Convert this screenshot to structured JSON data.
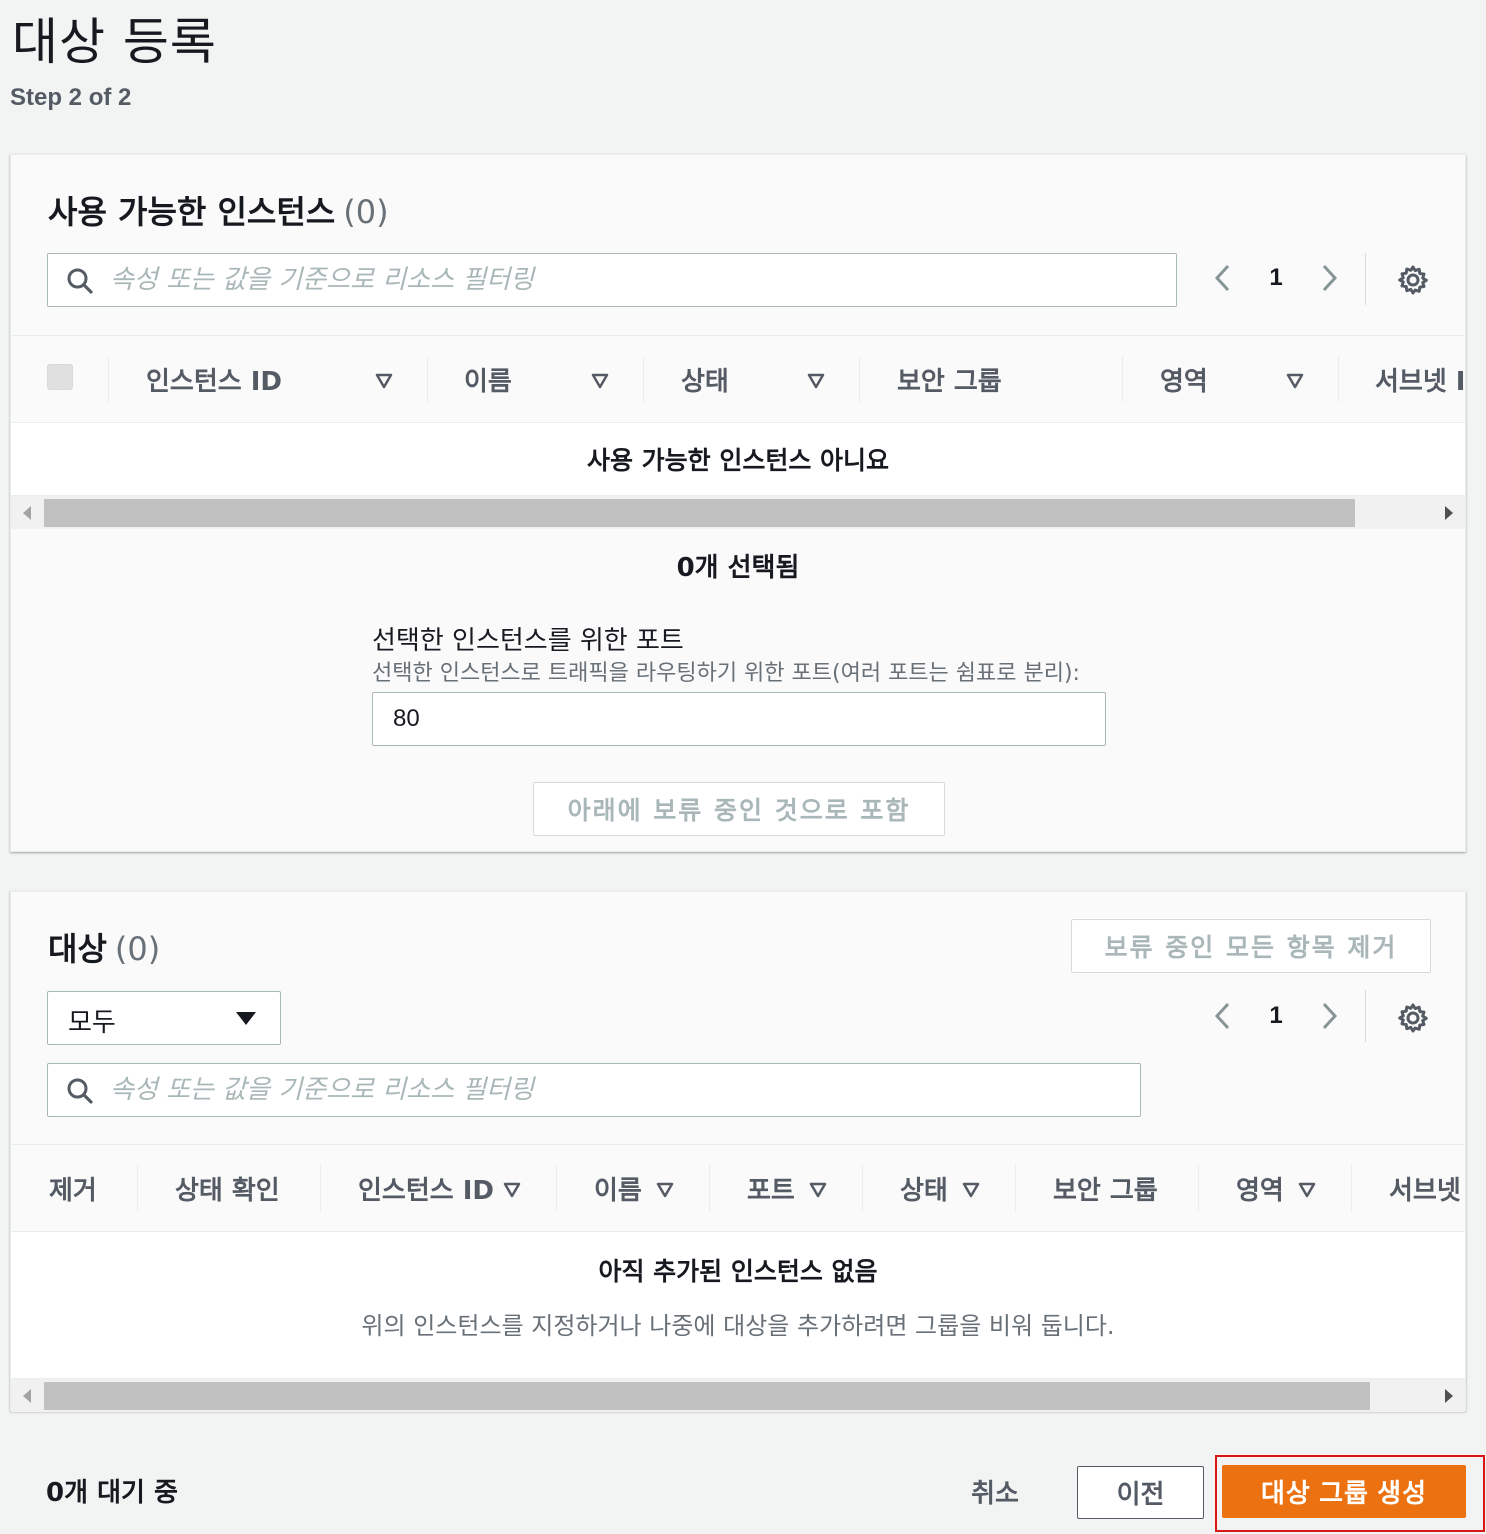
{
  "header": {
    "title": "대상 등록",
    "step": "Step 2 of 2"
  },
  "available": {
    "title": "사용 가능한 인스턴스",
    "count": "(0)",
    "search_placeholder": "속성 또는 값을 기준으로 리소스 필터링",
    "page": "1",
    "columns": [
      {
        "label": "인스턴스 ID"
      },
      {
        "label": "이름"
      },
      {
        "label": "상태"
      },
      {
        "label": "보안 그룹"
      },
      {
        "label": "영역"
      },
      {
        "label": "서브넷 I"
      }
    ],
    "empty_message": "사용 가능한 인스턴스 아니요",
    "selected_count": "0개 선택됨",
    "port_label": "선택한 인스턴스를 위한 포트",
    "port_description": "선택한 인스턴스로 트래픽을 라우팅하기 위한 포트(여러 포트는 쉼표로 분리):",
    "port_value": "80",
    "include_button": "아래에 보류 중인 것으로 포함"
  },
  "targets": {
    "title": "대상",
    "count": "(0)",
    "remove_all_button": "보류 중인 모든 항목 제거",
    "filter_select": "모두",
    "search_placeholder": "속성 또는 값을 기준으로 리소스 필터링",
    "page": "1",
    "columns": [
      {
        "label": "제거"
      },
      {
        "label": "상태 확인"
      },
      {
        "label": "인스턴스 ID"
      },
      {
        "label": "이름"
      },
      {
        "label": "포트"
      },
      {
        "label": "상태"
      },
      {
        "label": "보안 그룹"
      },
      {
        "label": "영역"
      },
      {
        "label": "서브넷"
      }
    ],
    "empty_title": "아직 추가된 인스턴스 없음",
    "empty_description": "위의 인스턴스를 지정하거나 나중에 대상을 추가하려면 그룹을 비워 둡니다."
  },
  "footer": {
    "pending": "0개 대기 중",
    "cancel": "취소",
    "previous": "이전",
    "create": "대상 그룹 생성"
  },
  "colors": {
    "primary": "#ec7211",
    "highlight": "#d91515",
    "text_secondary": "#545b64"
  }
}
